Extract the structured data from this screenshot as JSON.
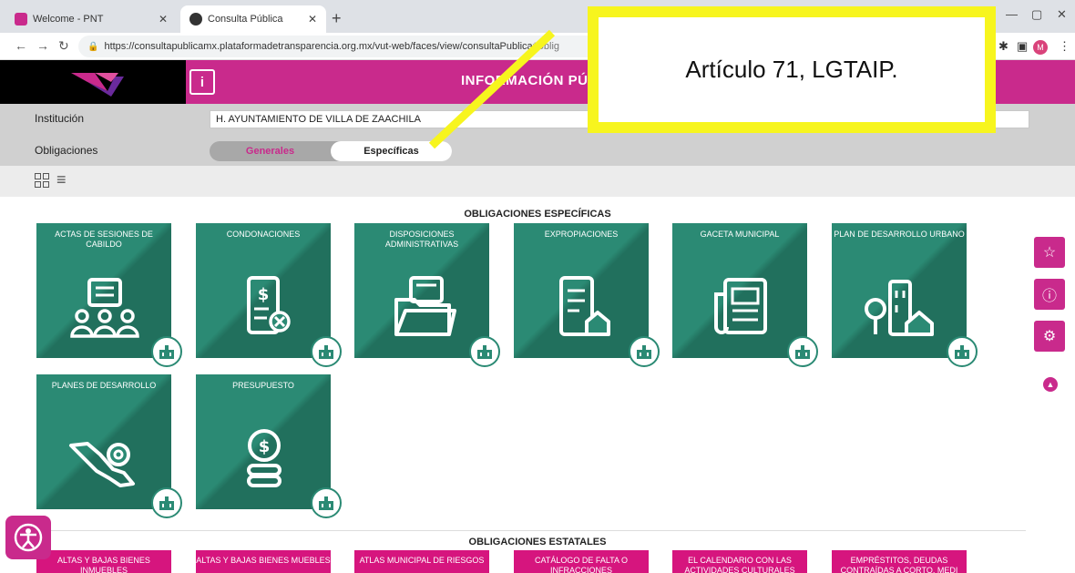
{
  "browser": {
    "tabs": [
      {
        "title": "Welcome - PNT",
        "active": false
      },
      {
        "title": "Consulta Pública",
        "active": true
      }
    ],
    "url_main": "https://consultapublicamx.plataformadetransparencia.org.mx/vut-web/faces/view/consultaPublica",
    "url_tail": "#oblig",
    "profile_initial": "M"
  },
  "header": {
    "title": "INFORMACIÓN PÚBLICA",
    "brand_color": "#c92a8c"
  },
  "filters": {
    "institucion_label": "Institución",
    "institucion_value": "H. AYUNTAMIENTO DE VILLA DE ZAACHILA",
    "obligaciones_label": "Obligaciones",
    "option_generales": "Generales",
    "option_especificas": "Específicas"
  },
  "sections": {
    "especificas_title": "OBLIGACIONES ESPECÍFICAS",
    "estatales_title": "OBLIGACIONES ESTATALES"
  },
  "cards": [
    {
      "title": "ACTAS DE SESIONES DE CABILDO",
      "icon": "people-document-icon"
    },
    {
      "title": "CONDONACIONES",
      "icon": "invoice-cancel-icon"
    },
    {
      "title": "DISPOSICIONES ADMINISTRATIVAS",
      "icon": "folder-icon"
    },
    {
      "title": "EXPROPIACIONES",
      "icon": "document-house-icon"
    },
    {
      "title": "GACETA MUNICIPAL",
      "icon": "newspaper-icon"
    },
    {
      "title": "PLAN DE DESARROLLO URBANO",
      "icon": "city-icon"
    },
    {
      "title": "PLANES DE DESARROLLO",
      "icon": "map-gear-icon"
    },
    {
      "title": "PRESUPUESTO",
      "icon": "coins-icon"
    }
  ],
  "estatales": [
    "ALTAS Y BAJAS BIENES INMUEBLES",
    "ALTAS Y BAJAS BIENES MUEBLES",
    "ATLAS MUNICIPAL DE RIESGOS",
    "CATÁLOGO DE FALTA O INFRACCIONES",
    "EL CALENDARIO CON LAS ACTIVIDADES CULTURALES",
    "EMPRÉSTITOS, DEUDAS CONTRAÍDAS A CORTO, MEDI"
  ],
  "annotation": {
    "text": "Artículo 71, LGTAIP.",
    "color": "#f7f51e"
  }
}
